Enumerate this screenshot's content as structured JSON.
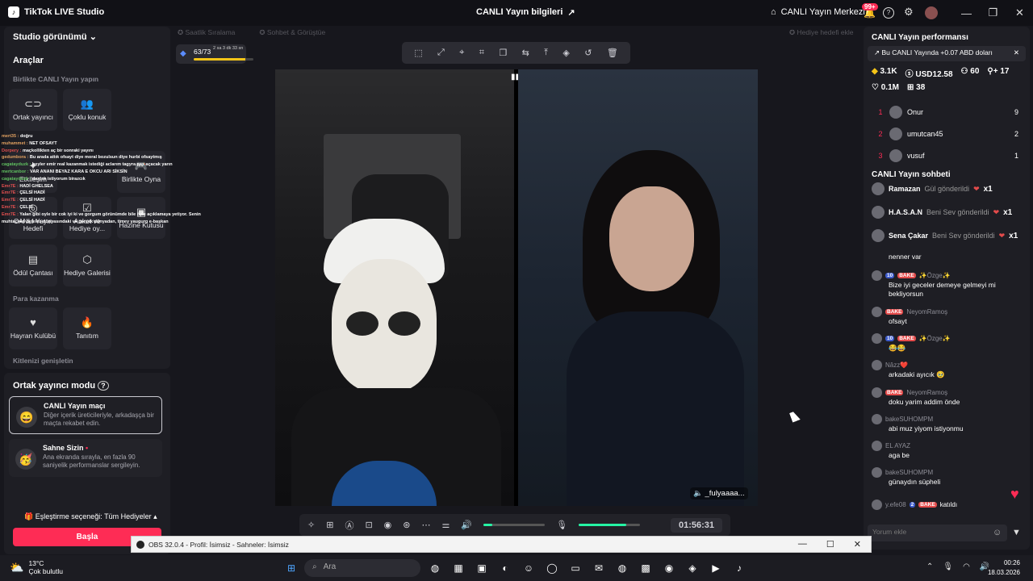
{
  "app": {
    "title": "TikTok LIVE Studio",
    "center_title": "CANLI Yayın bilgileri",
    "live_center": "CANLI Yayın Merkezi",
    "notif_badge": "99+"
  },
  "left": {
    "studio_view": "Studio görünümü",
    "tools_title": "Araçlar",
    "together_title": "Birlikte CANLI Yayın yapın",
    "tiles_row1": [
      "Ortak yayıncı",
      "Çoklu konuk"
    ],
    "tiles_row2": [
      "Etkileşim",
      "Birlikte Oyna"
    ],
    "tiles_row3": [
      "CANLI Yayın Hedefi",
      "Anket ve Hediye oy...",
      "Hazine Kutusu"
    ],
    "tiles_row4": [
      "Ödül Çantası",
      "Hediye Galerisi"
    ],
    "earn_title": "Para kazanma",
    "tiles_row5": [
      "Hayran Kulübü",
      "Tanıtım"
    ],
    "expand_title": "Kitlenizi genişletin",
    "cohost_mode": "Ortak yayıncı modu",
    "match_title": "CANLI Yayın maçı",
    "match_desc": "Diğer içerik üreticileriyle, arkadaşça bir maçta rekabet edin.",
    "stage_title": "Sahne Sizin",
    "stage_desc": "Ana ekranda sırayla, en fazla 90 saniyelik performanslar sergileyin.",
    "match_option": "Eşleştirme seçeneği: Tüm Hediyeler",
    "start": "Başla"
  },
  "overlay_chat": [
    {
      "u": "mert35",
      "t": "doğru",
      "c": "#e0a060"
    },
    {
      "u": "muhammet",
      "t": "NET OFSAYT",
      "c": "#e0a060"
    },
    {
      "u": "Dorpery",
      "t": "maçkollikten aç bir sonraki yayını",
      "c": "#e05050"
    },
    {
      "u": "gedumbora",
      "t": "Bu arada attık ofsayt diye moral bozulsun diye hurbi ofsaytmış",
      "c": "#e0a060"
    },
    {
      "u": "cagatayduzk",
      "t": "beyler emir real kazanmak istediği aclarım tagyra pas açacak yarın",
      "c": "#60c060"
    },
    {
      "u": "mertcanbor",
      "t": "VAR ANANI BEYAZ KARA E OKCU ARI SİKSİN",
      "c": "#60c060"
    },
    {
      "u": "cagatayduzk",
      "t": "destek istiyorum birazcık",
      "c": "#60c060"
    },
    {
      "u": "Emr7E",
      "t": "HADİ GHELSEA",
      "c": "#e05050"
    },
    {
      "u": "Emr7E",
      "t": "ÇELSİ HADİ",
      "c": "#e05050"
    },
    {
      "u": "Emr7E",
      "t": "ÇELSİ HADİ",
      "c": "#e05050"
    },
    {
      "u": "Emr7E",
      "t": "ÇELSİ",
      "c": "#e05050"
    },
    {
      "u": "Emr7E",
      "t": "Yalan gibi oyle bir cok iyi ki ve gorgum görünümde bile öyle açıklamaya yetiyor. Senin",
      "c": "#e05050"
    },
    {
      "u": "",
      "t": "muhtaçken belelen dünyasındaki ve gerçek dünyadan, timey yaugurg e-başkan",
      "c": "#e0e0e0"
    }
  ],
  "stream": {
    "hourly_rank": "Saatlik Sıralama",
    "chat_chat": "Sohbet & Görüştüe",
    "gift_wish": "Hediye hedefi ekle",
    "goal": "63/73",
    "goal_time": "2 sa 3 dk 33 sn",
    "goal_progress": 0.86,
    "cohost_name": "_fulyaaaa...",
    "timer": "01:56:31",
    "volume_level": 0.14,
    "mic_level": 0.78,
    "toolbar_icons": [
      "select-icon",
      "fit-icon",
      "center-icon",
      "crop-icon",
      "copy-icon",
      "flip-icon",
      "up-icon",
      "layers-icon",
      "rotate-icon",
      "delete-icon"
    ]
  },
  "right": {
    "perf_title": "CANLI Yayın performansı",
    "perf_line": "Bu CANLI Yayında +0.07 ABD doları",
    "stats": [
      "3.1K",
      "USD12.58",
      "60",
      "17",
      "0.1M",
      "38"
    ],
    "ranking": [
      {
        "n": "1",
        "name": "Onur",
        "v": "9"
      },
      {
        "n": "2",
        "name": "umutcan45",
        "v": "2"
      },
      {
        "n": "3",
        "name": "vusuf",
        "v": "1"
      }
    ],
    "chat_title": "CANLI Yayın sohbeti",
    "gifts": [
      {
        "u": "Ramazan",
        "g": "Gül gönderildi",
        "x": "x1"
      },
      {
        "u": "H.A.S.A.N",
        "g": "Beni Sev gönderildi",
        "x": "x1"
      },
      {
        "u": "Sena Çakar",
        "g": "Beni Sev gönderildi",
        "x": "x1"
      }
    ],
    "messages": [
      {
        "u": "",
        "tags": "",
        "t": "nenner var"
      },
      {
        "u": "✨Özge✨",
        "tags": "10|BAKE",
        "t": "Bize iyi geceler demeye gelmeyi mi bekliyorsun"
      },
      {
        "u": "NeyomRamoş",
        "tags": "BAKE",
        "t": "ofsayt"
      },
      {
        "u": "✨Özge✨",
        "tags": "10|BAKE",
        "t": "😂😂"
      },
      {
        "u": "Nâzz❤️",
        "tags": "",
        "t": "arkadaki ayıcık 🥹"
      },
      {
        "u": "NeyomRamoş",
        "tags": "BAKE",
        "t": "doku yarim addim önde"
      },
      {
        "u": "bakeSUHOMPM",
        "tags": "",
        "t": "abi muz yiyom istiyonmu"
      },
      {
        "u": "EL AYAZ",
        "tags": "",
        "t": "aga be"
      },
      {
        "u": "bakeSUHOMPM",
        "tags": "",
        "t": "günaydın süpheli"
      }
    ],
    "join_user": "y.efe08",
    "join_level": "2",
    "join_text": "katıldı",
    "comment_placeholder": "Yorum ekle"
  },
  "obs": {
    "title": "OBS 32.0.4 - Profil: İsimsiz - Sahneler: İsimsiz"
  },
  "taskbar": {
    "temp": "13°C",
    "weather": "Çok bulutlu",
    "search": "Ara",
    "time": "00:26",
    "date": "18.03.2026"
  }
}
